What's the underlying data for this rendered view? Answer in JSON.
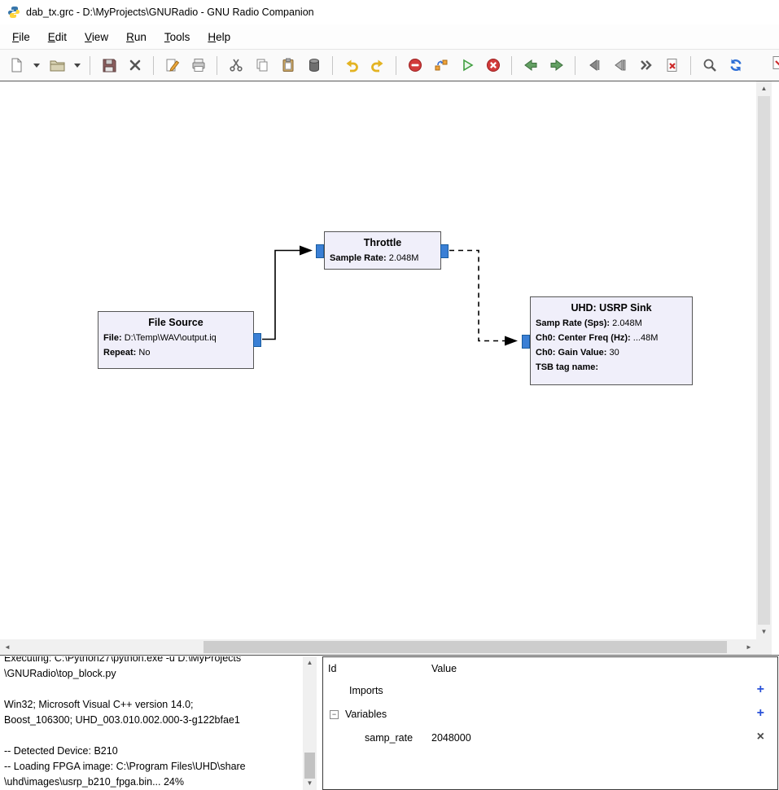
{
  "window": {
    "title": "dab_tx.grc - D:\\MyProjects\\GNURadio - GNU Radio Companion"
  },
  "menu": {
    "items": [
      "File",
      "Edit",
      "View",
      "Run",
      "Tools",
      "Help"
    ]
  },
  "toolbar": {
    "buttons": [
      "new",
      "new-dropdown",
      "open",
      "open-dropdown",
      "save",
      "close",
      "edit-properties",
      "print",
      "cut",
      "copy",
      "paste",
      "delete",
      "undo",
      "redo",
      "errors",
      "generate",
      "run",
      "kill",
      "back",
      "forward",
      "enable-block",
      "disable-block",
      "bypass-block",
      "flowgraph-errors",
      "find",
      "reload"
    ]
  },
  "canvas": {
    "blocks": [
      {
        "title": "File Source",
        "params": [
          {
            "k": "File:",
            "v": "D:\\Temp\\WAV\\output.iq"
          },
          {
            "k": "Repeat:",
            "v": "No"
          }
        ]
      },
      {
        "title": "Throttle",
        "params": [
          {
            "k": "Sample Rate:",
            "v": "2.048M"
          }
        ]
      },
      {
        "title": "UHD: USRP Sink",
        "params": [
          {
            "k": "Samp Rate (Sps):",
            "v": "2.048M"
          },
          {
            "k": "Ch0: Center Freq (Hz):",
            "v": "...48M"
          },
          {
            "k": "Ch0: Gain Value:",
            "v": "30"
          },
          {
            "k": "TSB tag name:",
            "v": ""
          }
        ]
      }
    ]
  },
  "console": {
    "text": "Executing: C:\\Python27\\python.exe -u D:\\MyProjects\n\\GNURadio\\top_block.py\n\nWin32; Microsoft Visual C++ version 14.0;\nBoost_106300; UHD_003.010.002.000-3-g122bfae1\n\n-- Detected Device: B210\n-- Loading FPGA image: C:\\Program Files\\UHD\\share\n\\uhd\\images\\usrp_b210_fpga.bin... 24%"
  },
  "variables_panel": {
    "columns": {
      "id": "Id",
      "value": "Value"
    },
    "rows": [
      {
        "id": "Imports",
        "value": ""
      },
      {
        "id": "Variables",
        "value": ""
      },
      {
        "id": "samp_rate",
        "value": "2048000"
      }
    ]
  },
  "icons": {
    "up_arrow": "▲",
    "down_arrow": "▼",
    "left_arrow": "◄",
    "right_arrow": "►",
    "plus": "+",
    "remove": "×",
    "collapse": "−"
  },
  "colors": {
    "accent": "#2a52d8",
    "port": "#3a7fd5",
    "block_fill": "#f0effa",
    "run_green": "#3f9e3f",
    "stop_red": "#d23b3b"
  }
}
